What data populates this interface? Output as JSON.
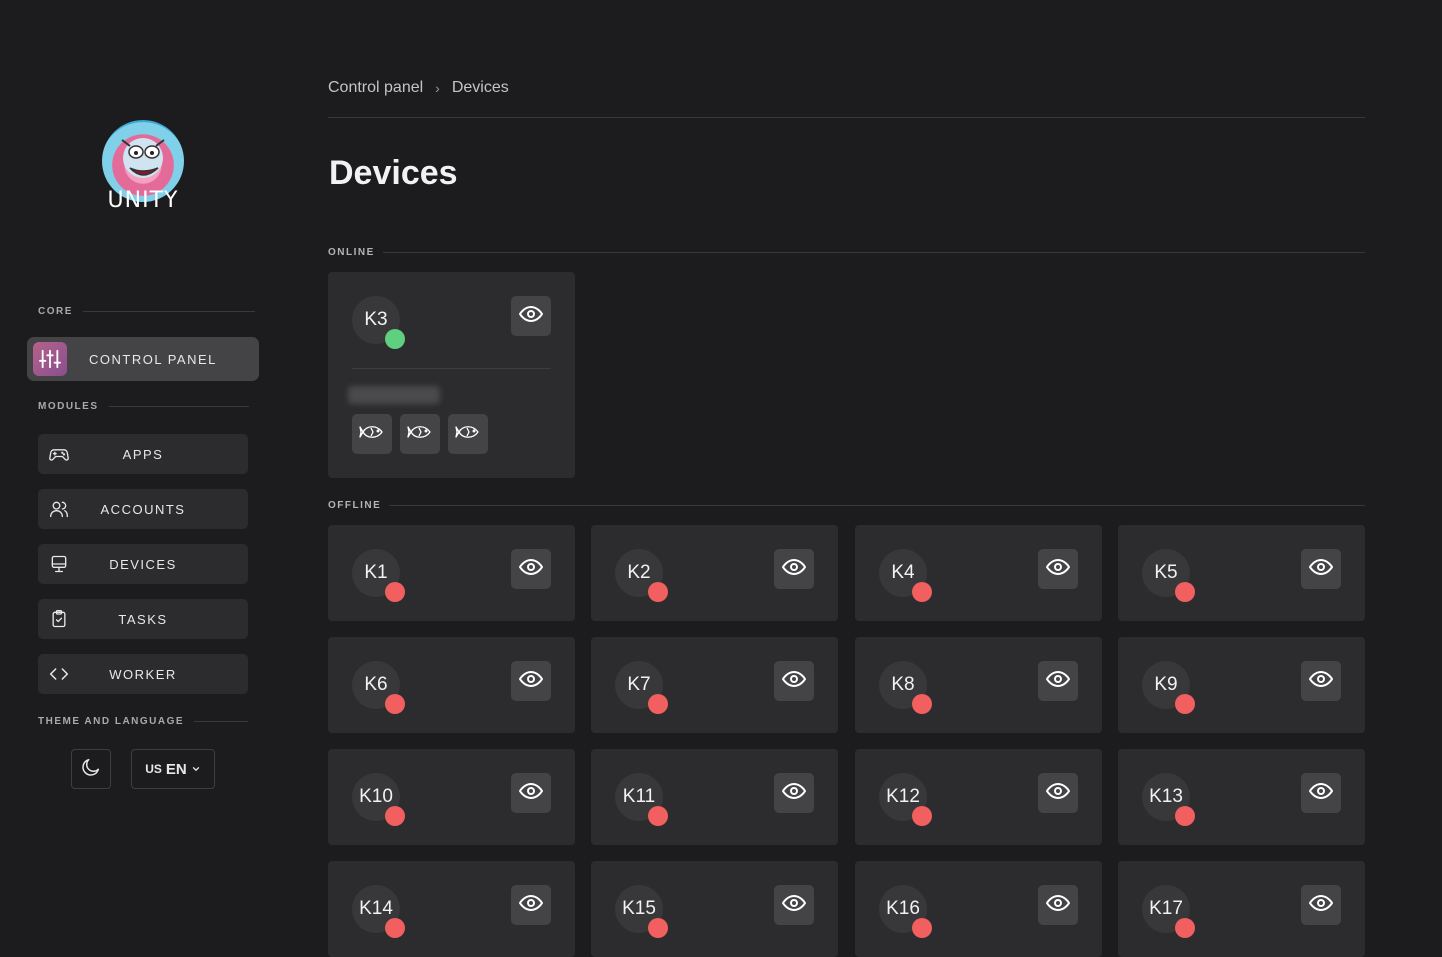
{
  "brand": {
    "name": "UNITY"
  },
  "sidebar": {
    "core_label": "CORE",
    "control_panel_label": "CONTROL PANEL",
    "modules_label": "MODULES",
    "modules": [
      {
        "label": "APPS",
        "icon": "gamepad-icon"
      },
      {
        "label": "ACCOUNTS",
        "icon": "users-icon"
      },
      {
        "label": "DEVICES",
        "icon": "monitor-icon"
      },
      {
        "label": "TASKS",
        "icon": "clipboard-check-icon"
      },
      {
        "label": "WORKER",
        "icon": "code-icon"
      }
    ],
    "theme_label": "THEME AND LANGUAGE",
    "language": {
      "flag": "US",
      "code": "EN"
    }
  },
  "breadcrumb": {
    "root": "Control panel",
    "current": "Devices"
  },
  "page_title": "Devices",
  "colors": {
    "online": "#5fcf80",
    "offline": "#f25f5f",
    "accent": "#a85a8c"
  },
  "online_label": "ONLINE",
  "offline_label": "OFFLINE",
  "online_devices": [
    {
      "name": "K3",
      "status": "online",
      "actions": [
        "fish-icon",
        "fish-icon",
        "fish-icon"
      ]
    }
  ],
  "offline_devices": [
    {
      "name": "K1"
    },
    {
      "name": "K2"
    },
    {
      "name": "K4"
    },
    {
      "name": "K5"
    },
    {
      "name": "K6"
    },
    {
      "name": "K7"
    },
    {
      "name": "K8"
    },
    {
      "name": "K9"
    },
    {
      "name": "K10"
    },
    {
      "name": "K11"
    },
    {
      "name": "K12"
    },
    {
      "name": "K13"
    },
    {
      "name": "K14"
    },
    {
      "name": "K15"
    },
    {
      "name": "K16"
    },
    {
      "name": "K17"
    }
  ]
}
